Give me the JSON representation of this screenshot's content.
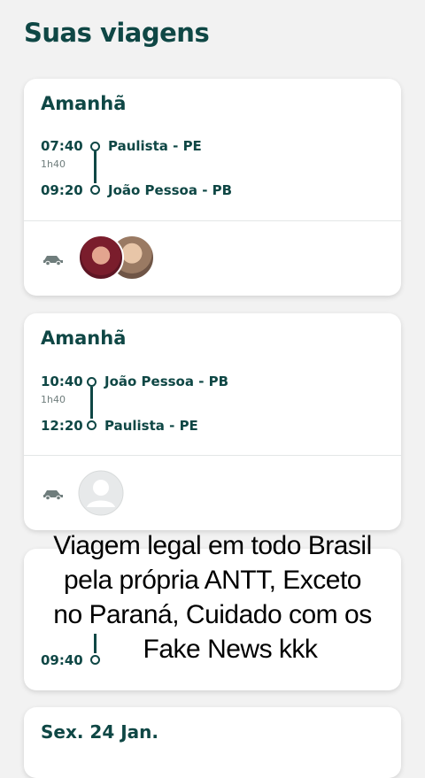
{
  "header": {
    "title": "Suas viagens"
  },
  "trips": [
    {
      "date": "Amanhã",
      "depart_time": "07:40",
      "duration": "1h40",
      "arrive_time": "09:20",
      "origin": "Paulista - PE",
      "destination": "João Pessoa - PB"
    },
    {
      "date": "Amanhã",
      "depart_time": "10:40",
      "duration": "1h40",
      "arrive_time": "12:20",
      "origin": "João Pessoa - PB",
      "destination": "Paulista - PE"
    },
    {
      "arrive_time": "09:40"
    },
    {
      "date": "Sex. 24 Jan."
    }
  ],
  "overlay_caption": {
    "lines": [
      "Viagem legal em todo Brasil",
      "pela própria ANTT, Exceto",
      "no Paraná, Cuidado com os",
      "Fake News kkk"
    ]
  },
  "colors": {
    "brand": "#0f4745",
    "background": "#f2f2f2",
    "card": "#ffffff"
  },
  "icons": {
    "vehicle": "car-icon",
    "passenger": "avatar"
  }
}
